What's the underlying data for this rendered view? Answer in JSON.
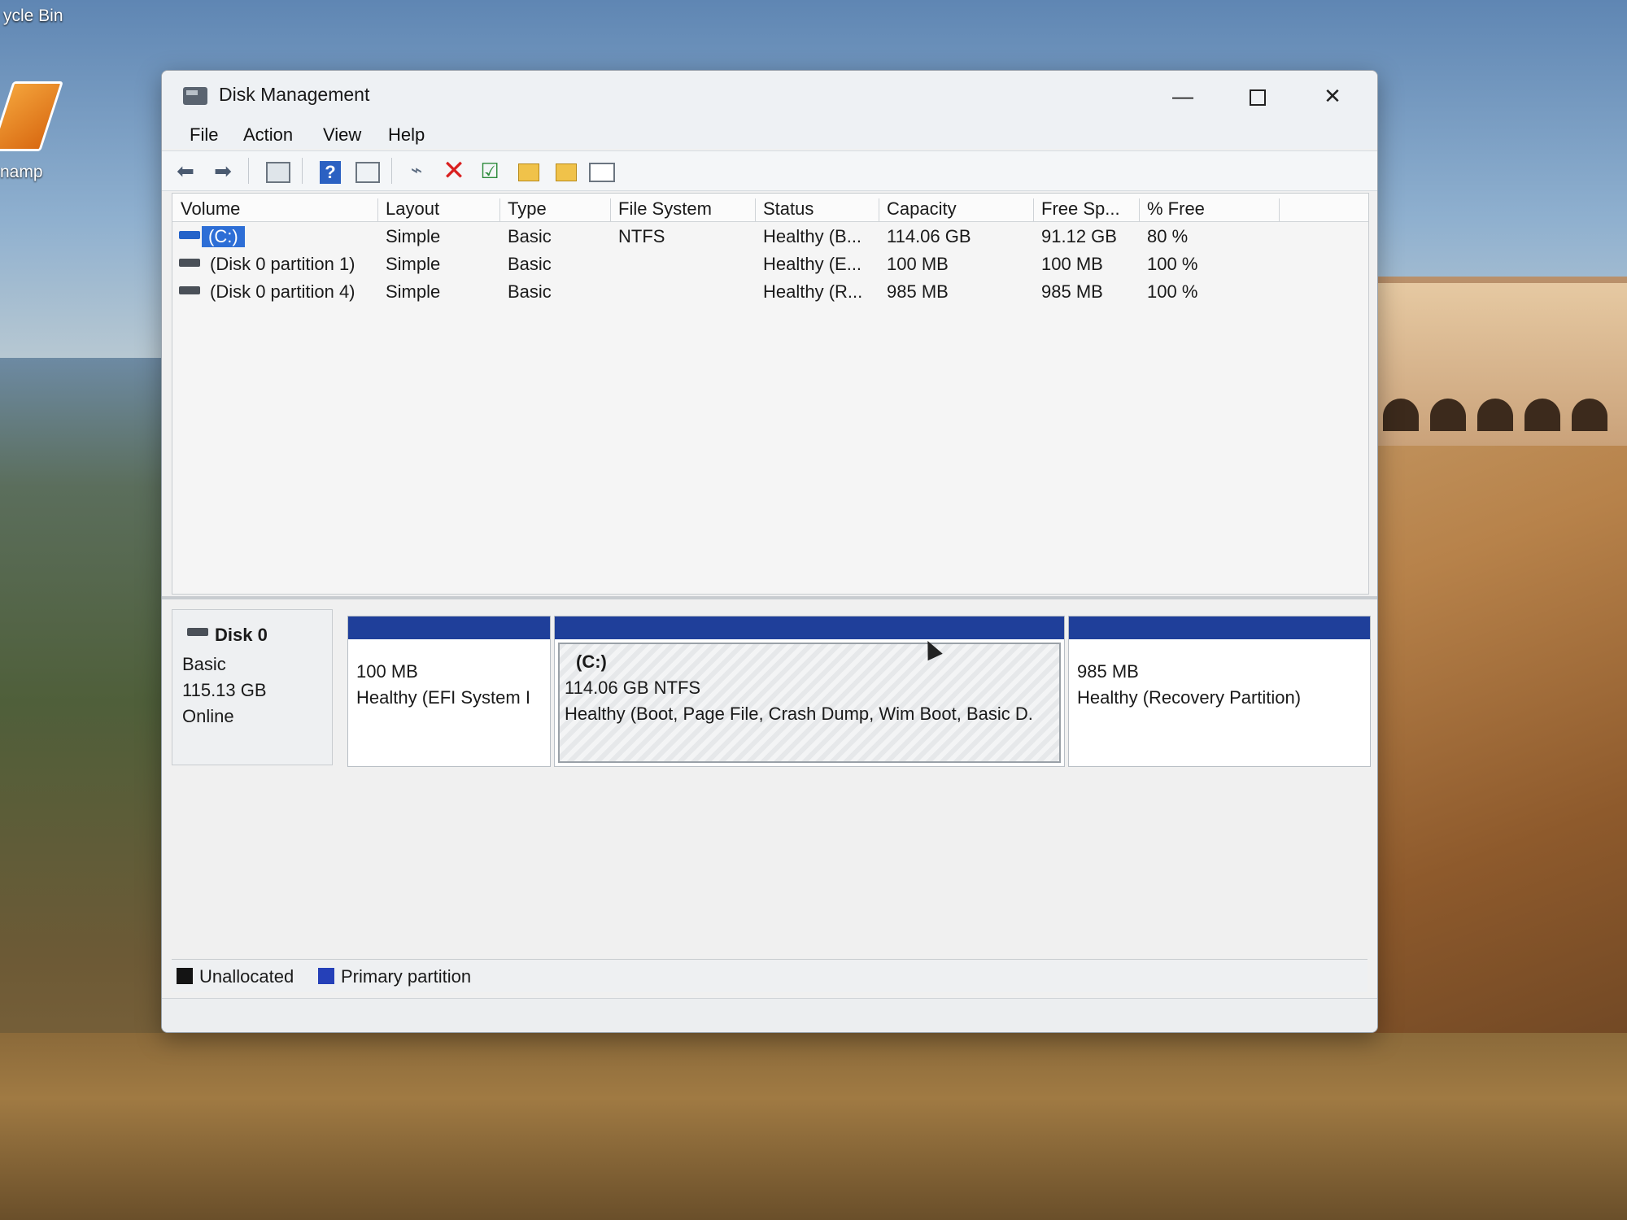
{
  "desktop": {
    "recycle_label": "ycle Bin",
    "winamp_label": "namp"
  },
  "window": {
    "title": "Disk Management",
    "min_symbol": "—",
    "close_symbol": "✕"
  },
  "menu": [
    "File",
    "Action",
    "View",
    "Help"
  ],
  "toolbar": {
    "back_icon": "arrow-left-icon",
    "forward_icon": "arrow-right-icon",
    "delete_symbol": "✕",
    "check_symbol": "☑",
    "help_symbol": "?",
    "connect_symbol": "⌁"
  },
  "volume_list": {
    "columns": [
      "Volume",
      "Layout",
      "Type",
      "File System",
      "Status",
      "Capacity",
      "Free Sp...",
      "% Free"
    ],
    "rows": [
      {
        "volume": "(C:)",
        "layout": "Simple",
        "type": "Basic",
        "file_system": "NTFS",
        "status": "Healthy (B...",
        "capacity": "114.06 GB",
        "free_space": "91.12 GB",
        "percent_free": "80 %"
      },
      {
        "volume": "(Disk 0 partition 1)",
        "layout": "Simple",
        "type": "Basic",
        "file_system": "",
        "status": "Healthy (E...",
        "capacity": "100 MB",
        "free_space": "100 MB",
        "percent_free": "100 %"
      },
      {
        "volume": "(Disk 0 partition 4)",
        "layout": "Simple",
        "type": "Basic",
        "file_system": "",
        "status": "Healthy (R...",
        "capacity": "985 MB",
        "free_space": "985 MB",
        "percent_free": "100 %"
      }
    ]
  },
  "disk": {
    "name": "Disk 0",
    "type": "Basic",
    "size": "115.13 GB",
    "state": "Online",
    "partitions": [
      {
        "title": "",
        "size": "100 MB",
        "status": "Healthy (EFI System I"
      },
      {
        "title": "(C:)",
        "size": "114.06 GB NTFS",
        "status": "Healthy (Boot, Page File, Crash Dump, Wim Boot, Basic D."
      },
      {
        "title": "",
        "size": "985 MB",
        "status": "Healthy (Recovery Partition)"
      }
    ]
  },
  "legend": {
    "unallocated": "Unallocated",
    "primary": "Primary partition"
  },
  "colors": {
    "partition_bar": "#1f3f9a",
    "selection": "#2d6ed6",
    "unallocated": "#141414",
    "primary": "#2540b8"
  }
}
